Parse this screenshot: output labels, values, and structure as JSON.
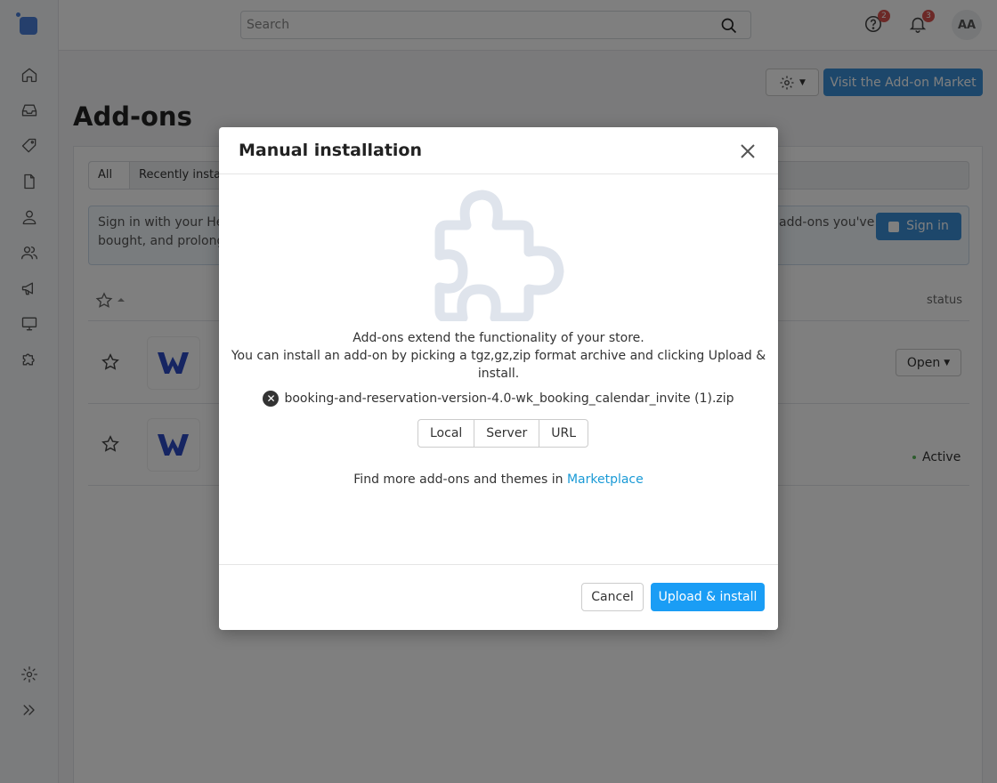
{
  "topbar": {
    "search_placeholder": "Search",
    "help_badge": "2",
    "notifications_badge": "3",
    "avatar_initials": "AA"
  },
  "page": {
    "title": "Add-ons",
    "market_button": "Visit the Add-on Market",
    "tabs": [
      "All",
      "Recently install"
    ],
    "notice_left_line1": "Sign in with your Help",
    "notice_left_line2": "bought, and prolong y",
    "notice_right": "add-ons you've",
    "signin_button": "Sign in",
    "status_header": "status",
    "row1_action": "Open",
    "row2_status": "Active"
  },
  "modal": {
    "title": "Manual installation",
    "desc_line1": "Add-ons extend the functionality of your store.",
    "desc_line2": "You can install an add-on by picking a tgz,gz,zip format archive and clicking Upload & install.",
    "file_name": "booking-and-reservation-version-4.0-wk_booking_calendar_invite (1).zip",
    "sources": [
      "Local",
      "Server",
      "URL"
    ],
    "more_text": "Find more add-ons and themes in ",
    "more_link": "Marketplace",
    "cancel_label": "Cancel",
    "upload_label": "Upload & install"
  },
  "colors": {
    "accent": "#1a9df5",
    "link": "#1a9ad6",
    "badge": "#d9534f",
    "puzzle": "#dfe4ec"
  }
}
